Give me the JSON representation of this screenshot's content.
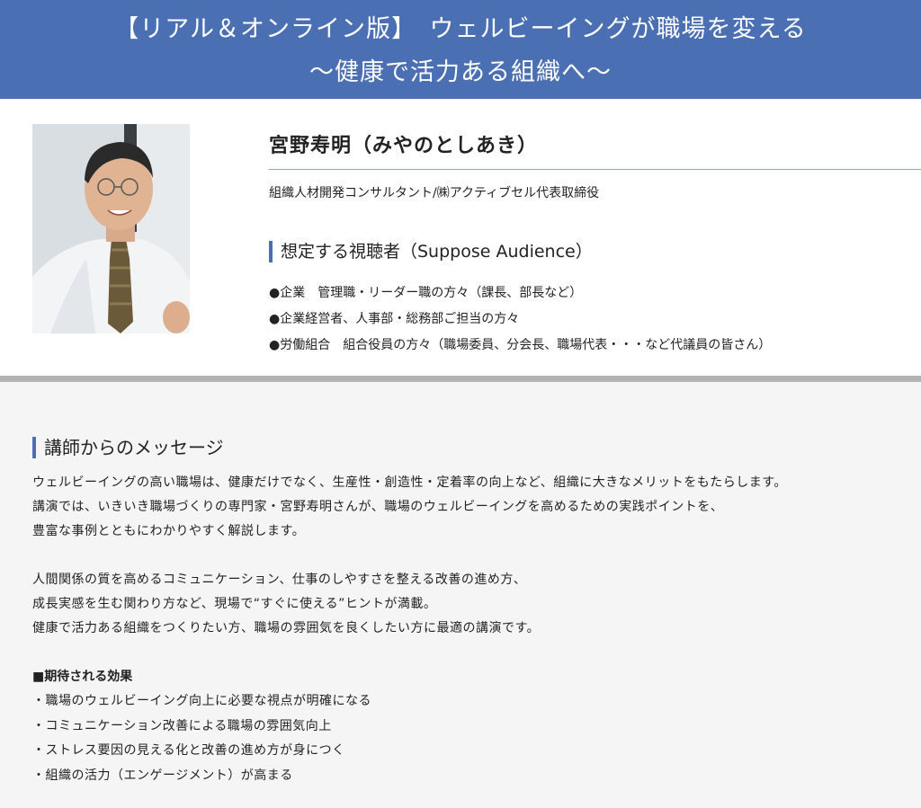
{
  "banner": {
    "line1": "【リアル＆オンライン版】　ウェルビーイングが職場を変える",
    "line2": "〜健康で活力ある組織へ〜"
  },
  "speaker": {
    "name": "宮野寿明（みやのとしあき）",
    "role": "組織人材開発コンサルタント/㈱アクティブセル代表取締役"
  },
  "audience": {
    "title": "想定する視聴者（Suppose Audience）",
    "items": [
      "●企業　管理職・リーダー職の方々（課長、部長など）",
      "●企業経営者、人事部・総務部ご担当の方々",
      "●労働組合　組合役員の方々（職場委員、分会長、職場代表・・・など代議員の皆さん）"
    ]
  },
  "message": {
    "title": "講師からのメッセージ",
    "paragraph1": [
      "ウェルビーイングの高い職場は、健康だけでなく、生産性・創造性・定着率の向上など、組織に大きなメリットをもたらします。",
      "講演では、いきいき職場づくりの専門家・宮野寿明さんが、職場のウェルビーイングを高めるための実践ポイントを、",
      "豊富な事例とともにわかりやすく解説します。"
    ],
    "paragraph2": [
      "人間関係の質を高めるコミュニケーション、仕事のしやすさを整える改善の進め方、",
      "成長実感を生む関わり方など、現場で“すぐに使える”ヒントが満載。",
      "健康で活力ある組織をつくりたい方、職場の雰囲気を良くしたい方に最適の講演です。"
    ],
    "effects_title": "■期待される効果",
    "effects": [
      "・職場のウェルビーイング向上に必要な視点が明確になる",
      "・コミュニケーション改善による職場の雰囲気向上",
      "・ストレス要因の見える化と改善の進め方が身につく",
      "・組織の活力（エンゲージメント）が高まる"
    ]
  },
  "colors": {
    "banner": "#4a6fb3",
    "accent": "#4a6fb3",
    "divider": "#b3b3b3"
  }
}
